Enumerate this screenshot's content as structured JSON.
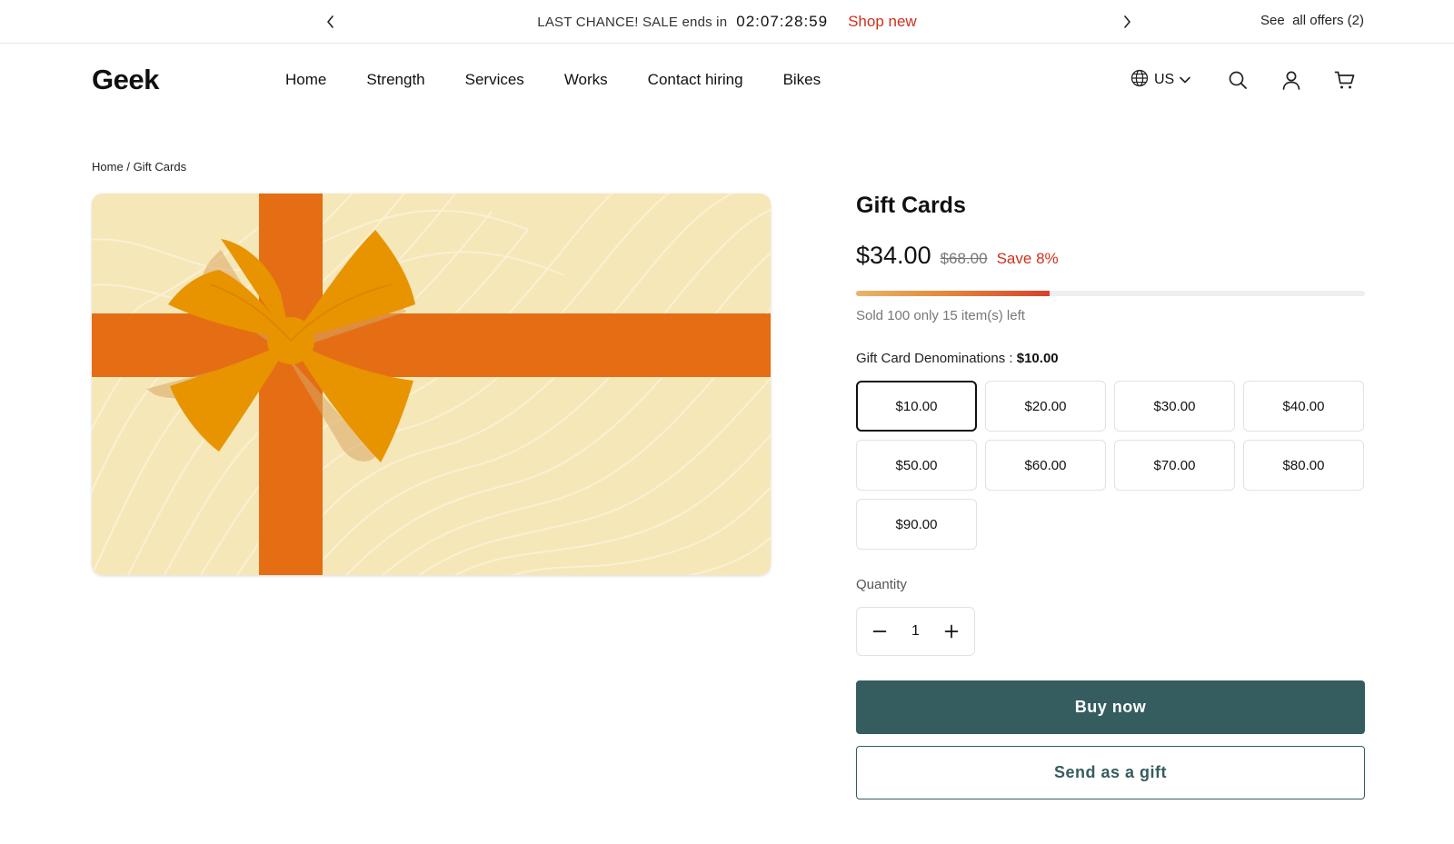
{
  "announcement": {
    "message": "LAST CHANCE! SALE ends in",
    "countdown": "02:07:28:59",
    "shop_link": "Shop new",
    "offers_link": "See  all offers (2)"
  },
  "header": {
    "logo": "Geek",
    "nav": [
      "Home",
      "Strength",
      "Services",
      "Works",
      "Contact hiring",
      "Bikes"
    ],
    "locale": "US"
  },
  "breadcrumb": {
    "home": "Home",
    "separator": "/",
    "current": "Gift Cards"
  },
  "product": {
    "title": "Gift Cards",
    "price": "$34.00",
    "compare_price": "$68.00",
    "save": "Save 8%",
    "stock_progress_percent": 38,
    "sold_text": "Sold 100 only 15 item(s) left",
    "denomination_label": "Gift Card Denominations :",
    "denomination_selected": "$10.00",
    "denominations": [
      "$10.00",
      "$20.00",
      "$30.00",
      "$40.00",
      "$50.00",
      "$60.00",
      "$70.00",
      "$80.00",
      "$90.00"
    ],
    "quantity_label": "Quantity",
    "quantity": "1",
    "buy_now": "Buy now",
    "send_gift": "Send as a gift"
  },
  "colors": {
    "accent": "#355d60",
    "sale_red": "#d0301c",
    "card_bg": "#f6e7b8",
    "ribbon": "#e56e14",
    "bow": "#e89400"
  },
  "icons": [
    "chevron-left-icon",
    "chevron-right-icon",
    "globe-icon",
    "chevron-down-icon",
    "search-icon",
    "user-icon",
    "cart-icon",
    "minus-icon",
    "plus-icon"
  ]
}
